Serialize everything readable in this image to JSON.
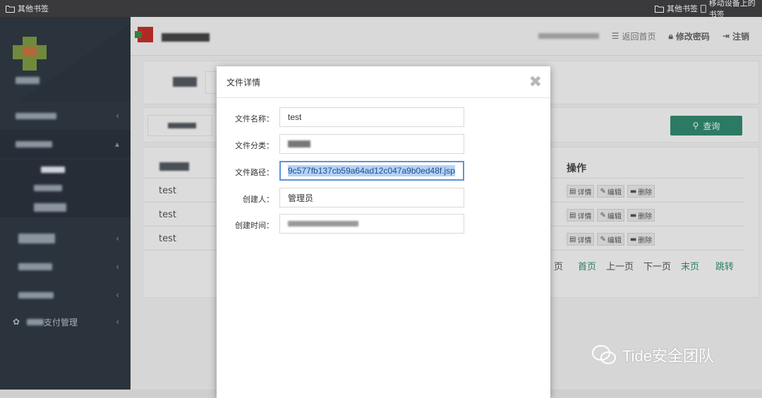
{
  "bookmarks": {
    "left_folder": "其他书签",
    "right_folder": "其他书签",
    "mobile": "移动设备上的书签"
  },
  "sidebar": {
    "items": [
      {
        "label": ""
      },
      {
        "label": ""
      },
      {
        "label": ""
      },
      {
        "label": ""
      },
      {
        "label": ""
      },
      {
        "label": "支付管理"
      }
    ]
  },
  "header": {
    "back_home": "返回首页",
    "change_password": "修改密码",
    "logout": "注销"
  },
  "toolbar": {
    "search_label": "查询"
  },
  "table": {
    "ops_header": "操作",
    "rows": [
      {
        "name": "test",
        "detail": "详情",
        "edit": "编辑",
        "delete": "删除"
      },
      {
        "name": "test",
        "detail": "详情",
        "edit": "编辑",
        "delete": "删除"
      },
      {
        "name": "test",
        "detail": "详情",
        "edit": "编辑",
        "delete": "删除"
      }
    ]
  },
  "pager": {
    "page": "页",
    "first": "首页",
    "prev": "上一页",
    "next": "下一页",
    "last": "末页",
    "jump": "跳转"
  },
  "modal": {
    "title": "文件详情",
    "close": "✖",
    "fields": [
      {
        "label": "文件名称：",
        "value": "test"
      },
      {
        "label": "文件分类：",
        "value": ""
      },
      {
        "label": "文件路径：",
        "value": "9c577fb137cb59a64ad12c047a9b0ed48f.jsp"
      },
      {
        "label": "创建人：",
        "value": "管理员"
      },
      {
        "label": "创建时间：",
        "value": ""
      }
    ]
  },
  "watermark": {
    "text": "Tide安全团队"
  },
  "colors": {
    "sidebar": "#2b333d",
    "accent_green": "#2c7a64",
    "focus_blue": "#5b95d9"
  }
}
